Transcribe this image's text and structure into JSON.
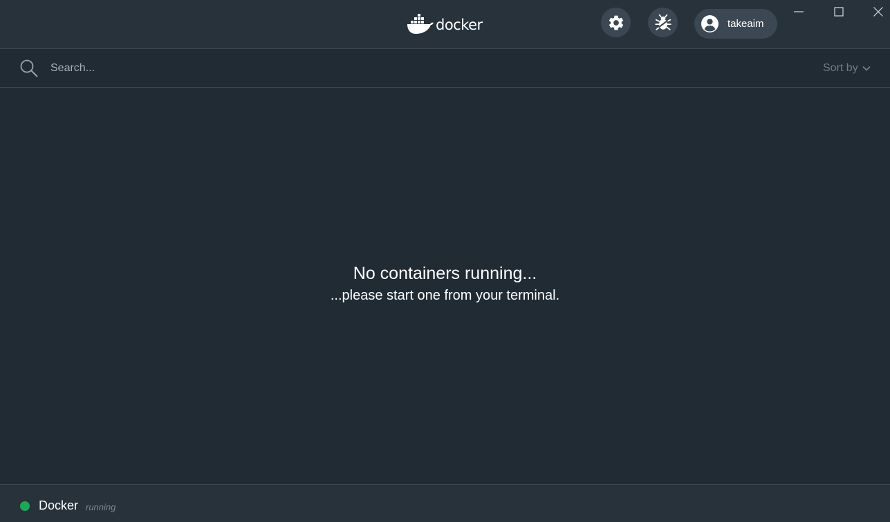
{
  "header": {
    "logo_text": "docker",
    "user_name": "takeaim",
    "icons": [
      "settings-gear-icon",
      "bug-report-icon",
      "account-icon",
      "minimize-icon",
      "maximize-icon",
      "close-icon"
    ]
  },
  "search": {
    "placeholder": "Search...",
    "value": "",
    "sort_label": "Sort by"
  },
  "empty_state": {
    "title": "No containers running...",
    "subtitle": "...please start one from your terminal."
  },
  "status": {
    "name": "Docker",
    "state": "running",
    "dot_color": "#1aaa55"
  },
  "colors": {
    "background": "#212b34",
    "titlebar": "#27323b",
    "button_bg": "#3b4853",
    "accent_green": "#1aaa55"
  }
}
